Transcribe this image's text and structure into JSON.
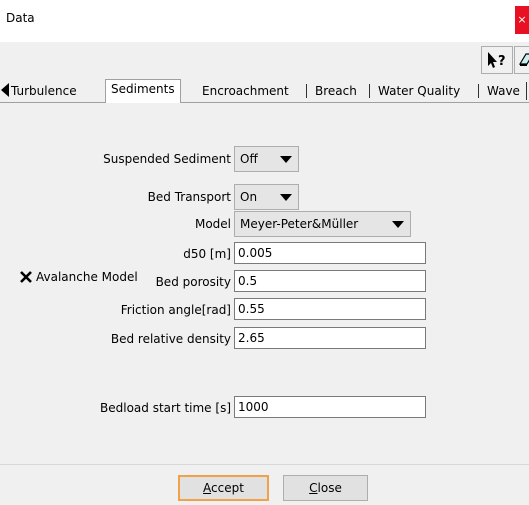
{
  "window": {
    "title": "Data",
    "close_glyph": "×"
  },
  "toolbar": {
    "help_icon": "whats-this-help-icon",
    "edit_icon": "edit-dropdown-icon"
  },
  "tabs": [
    {
      "label": "Turbulence"
    },
    {
      "label": "Sediments",
      "active": true
    },
    {
      "label": "Encroachment"
    },
    {
      "label": "Breach"
    },
    {
      "label": "Water Quality"
    },
    {
      "label": "Wave"
    }
  ],
  "sediments": {
    "suspended_sediment": {
      "label": "Suspended Sediment",
      "value": "Off"
    },
    "bed_transport": {
      "label": "Bed Transport",
      "value": "On"
    },
    "model": {
      "label": "Model",
      "value": "Meyer-Peter&Müller"
    },
    "d50": {
      "label": "d50 [m]",
      "value": "0.005"
    },
    "bed_porosity": {
      "label": "Bed porosity",
      "value": "0.5"
    },
    "friction_angle": {
      "label": "Friction angle[rad]",
      "value": "0.55"
    },
    "bed_relative_density": {
      "label": "Bed relative density",
      "value": "2.65"
    },
    "avalanche_model": {
      "label": "Avalanche Model",
      "checked": true
    },
    "bedload_start_time": {
      "label": "Bedload start time [s]",
      "value": "1000"
    }
  },
  "buttons": {
    "accept": {
      "mnemonic": "A",
      "rest": "ccept"
    },
    "close": {
      "mnemonic": "C",
      "rest": "lose"
    }
  },
  "colors": {
    "focus_border": "#f0a24a",
    "close_red": "#e81123"
  }
}
